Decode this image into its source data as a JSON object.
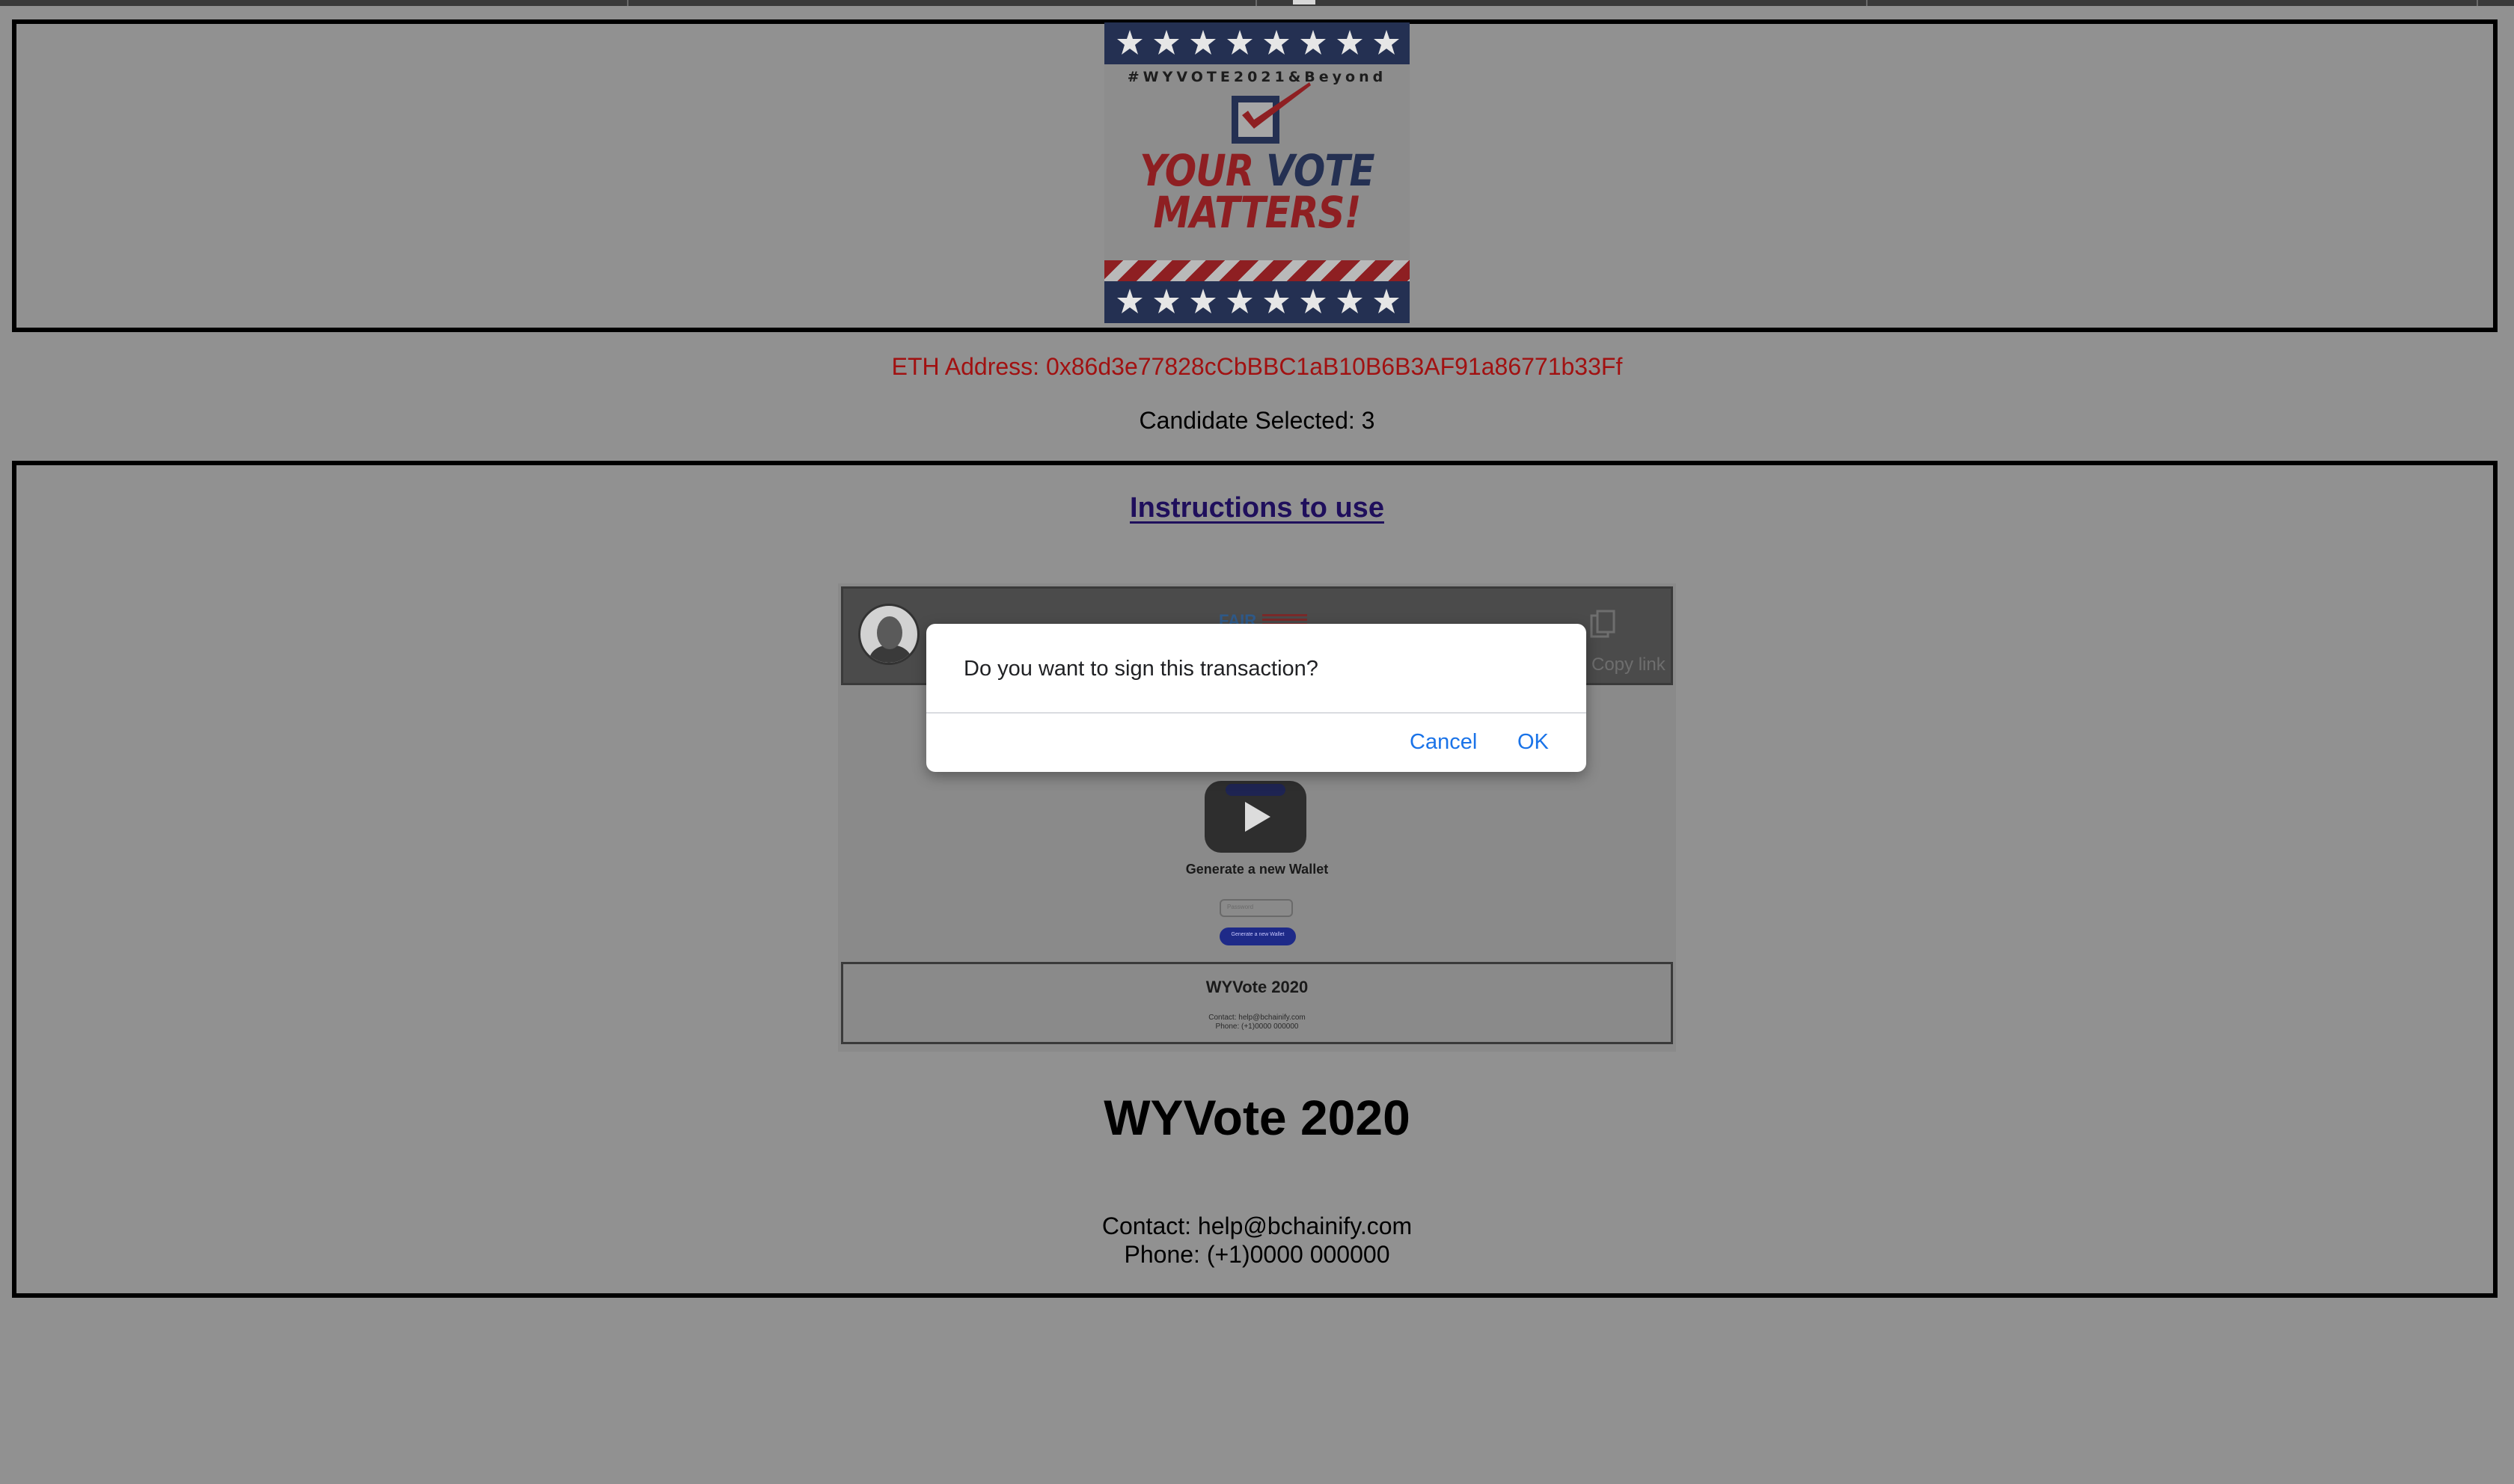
{
  "logo": {
    "hashtag": "#WYVOTE2021&Beyond",
    "slogan_word1": "YOUR",
    "slogan_word2": "VOTE",
    "slogan_word3": "MATTERS!"
  },
  "info": {
    "eth_address": "ETH Address: 0x86d3e77828cCbBBC1aB10B6B3AF91a86771b33Ff",
    "candidate_selected": "Candidate Selected: 3"
  },
  "instructions": {
    "link_label": "Instructions to use"
  },
  "video": {
    "copy_label": "Copy link",
    "fair_label": "FAIR",
    "generate_label": "Generate a new Wallet",
    "input_placeholder": "Password",
    "button_label": "Generate a new Wallet",
    "footer_title": "WYVote 2020",
    "footer_contact": "Contact: help@bchainify.com",
    "footer_phone": "Phone: (+1)0000 000000"
  },
  "footer": {
    "title": "WYVote 2020",
    "contact": "Contact: help@bchainify.com",
    "phone": "Phone: (+1)0000 000000"
  },
  "dialog": {
    "message": "Do you want to sign this transaction?",
    "cancel_label": "Cancel",
    "ok_label": "OK"
  },
  "colors": {
    "background": "#919191",
    "eth_text": "#a11111",
    "link": "#1f0f5c",
    "dialog_button": "#1a73e8",
    "navy": "#243052",
    "red": "#8e1f22"
  }
}
